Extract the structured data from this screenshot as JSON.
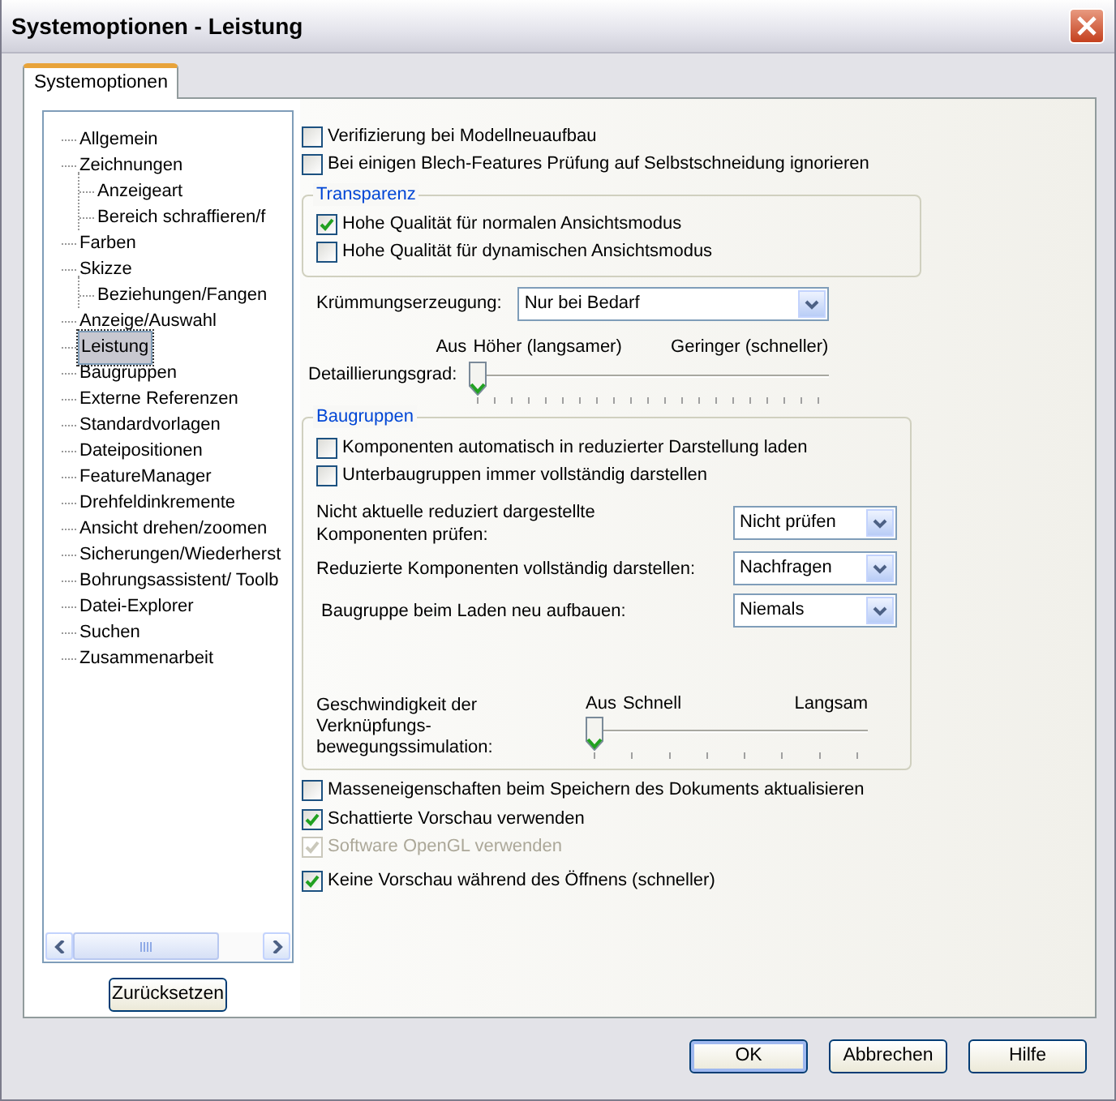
{
  "window": {
    "title": "Systemoptionen - Leistung"
  },
  "tabs": [
    {
      "label": "Systemoptionen",
      "selected": true
    }
  ],
  "tree": [
    {
      "label": "Allgemein",
      "selected": false
    },
    {
      "label": "Zeichnungen",
      "selected": false,
      "children": [
        {
          "label": "Anzeigeart",
          "selected": false
        },
        {
          "label": "Bereich schraffieren/f",
          "selected": false
        }
      ]
    },
    {
      "label": "Farben",
      "selected": false
    },
    {
      "label": "Skizze",
      "selected": false,
      "children": [
        {
          "label": "Beziehungen/Fangen",
          "selected": false
        }
      ]
    },
    {
      "label": "Anzeige/Auswahl",
      "selected": false
    },
    {
      "label": "Leistung",
      "selected": true
    },
    {
      "label": "Baugruppen",
      "selected": false
    },
    {
      "label": "Externe Referenzen",
      "selected": false
    },
    {
      "label": "Standardvorlagen",
      "selected": false
    },
    {
      "label": "Dateipositionen",
      "selected": false
    },
    {
      "label": "FeatureManager",
      "selected": false
    },
    {
      "label": "Drehfeldinkremente",
      "selected": false
    },
    {
      "label": "Ansicht drehen/zoomen",
      "selected": false
    },
    {
      "label": "Sicherungen/Wiederherst",
      "selected": false
    },
    {
      "label": "Bohrungsassistent/ Toolb",
      "selected": false
    },
    {
      "label": "Datei-Explorer",
      "selected": false
    },
    {
      "label": "Suchen",
      "selected": false
    },
    {
      "label": "Zusammenarbeit",
      "selected": false
    }
  ],
  "reset_button": "Zurücksetzen",
  "options_top": [
    {
      "label": "Verifizierung bei Modellneuaufbau",
      "checked": false
    },
    {
      "label": "Bei einigen Blech-Features Prüfung auf Selbstschneidung ignorieren",
      "checked": false
    }
  ],
  "transparency": {
    "title": "Transparenz",
    "options": [
      {
        "label": "Hohe Qualität für normalen Ansichtsmodus",
        "checked": true
      },
      {
        "label": "Hohe Qualität für dynamischen Ansichtsmodus",
        "checked": false
      }
    ]
  },
  "curvature": {
    "label": "Krümmungserzeugung:",
    "value": "Nur bei Bedarf"
  },
  "detail_slider": {
    "label": "Detaillierungsgrad:",
    "off_label": "Aus",
    "min_label": "Höher (langsamer)",
    "max_label": "Geringer (schneller)",
    "level": 0
  },
  "assemblies": {
    "title": "Baugruppen",
    "options": [
      {
        "label": "Komponenten automatisch in reduzierter Darstellung laden",
        "checked": false
      },
      {
        "label": "Unterbaugruppen immer vollständig darstellen",
        "checked": false
      }
    ],
    "selects": [
      {
        "label": "Nicht aktuelle reduziert dargestellte Komponenten prüfen:",
        "value": "Nicht prüfen"
      },
      {
        "label": "Reduzierte Komponenten vollständig darstellen:",
        "value": "Nachfragen"
      },
      {
        "label": "Baugruppe beim Laden neu aufbauen:",
        "value": "Niemals"
      }
    ],
    "slider": {
      "label": "Geschwindigkeit der Verknüpfungs- bewegungssimulation:",
      "off_label": "Aus",
      "min_label": "Schnell",
      "max_label": "Langsam",
      "level": 0
    }
  },
  "options_bottom": [
    {
      "label": "Masseneigenschaften beim Speichern des Dokuments aktualisieren",
      "checked": false,
      "disabled": false
    },
    {
      "label": "Schattierte Vorschau verwenden",
      "checked": true,
      "disabled": false
    },
    {
      "label": "Software OpenGL verwenden",
      "checked": true,
      "disabled": true
    },
    {
      "label": "Keine Vorschau während des Öffnens (schneller)",
      "checked": true,
      "disabled": false
    }
  ],
  "buttons": [
    {
      "label": "OK",
      "default": true
    },
    {
      "label": "Abbrechen",
      "default": false
    },
    {
      "label": "Hilfe",
      "default": false
    }
  ]
}
